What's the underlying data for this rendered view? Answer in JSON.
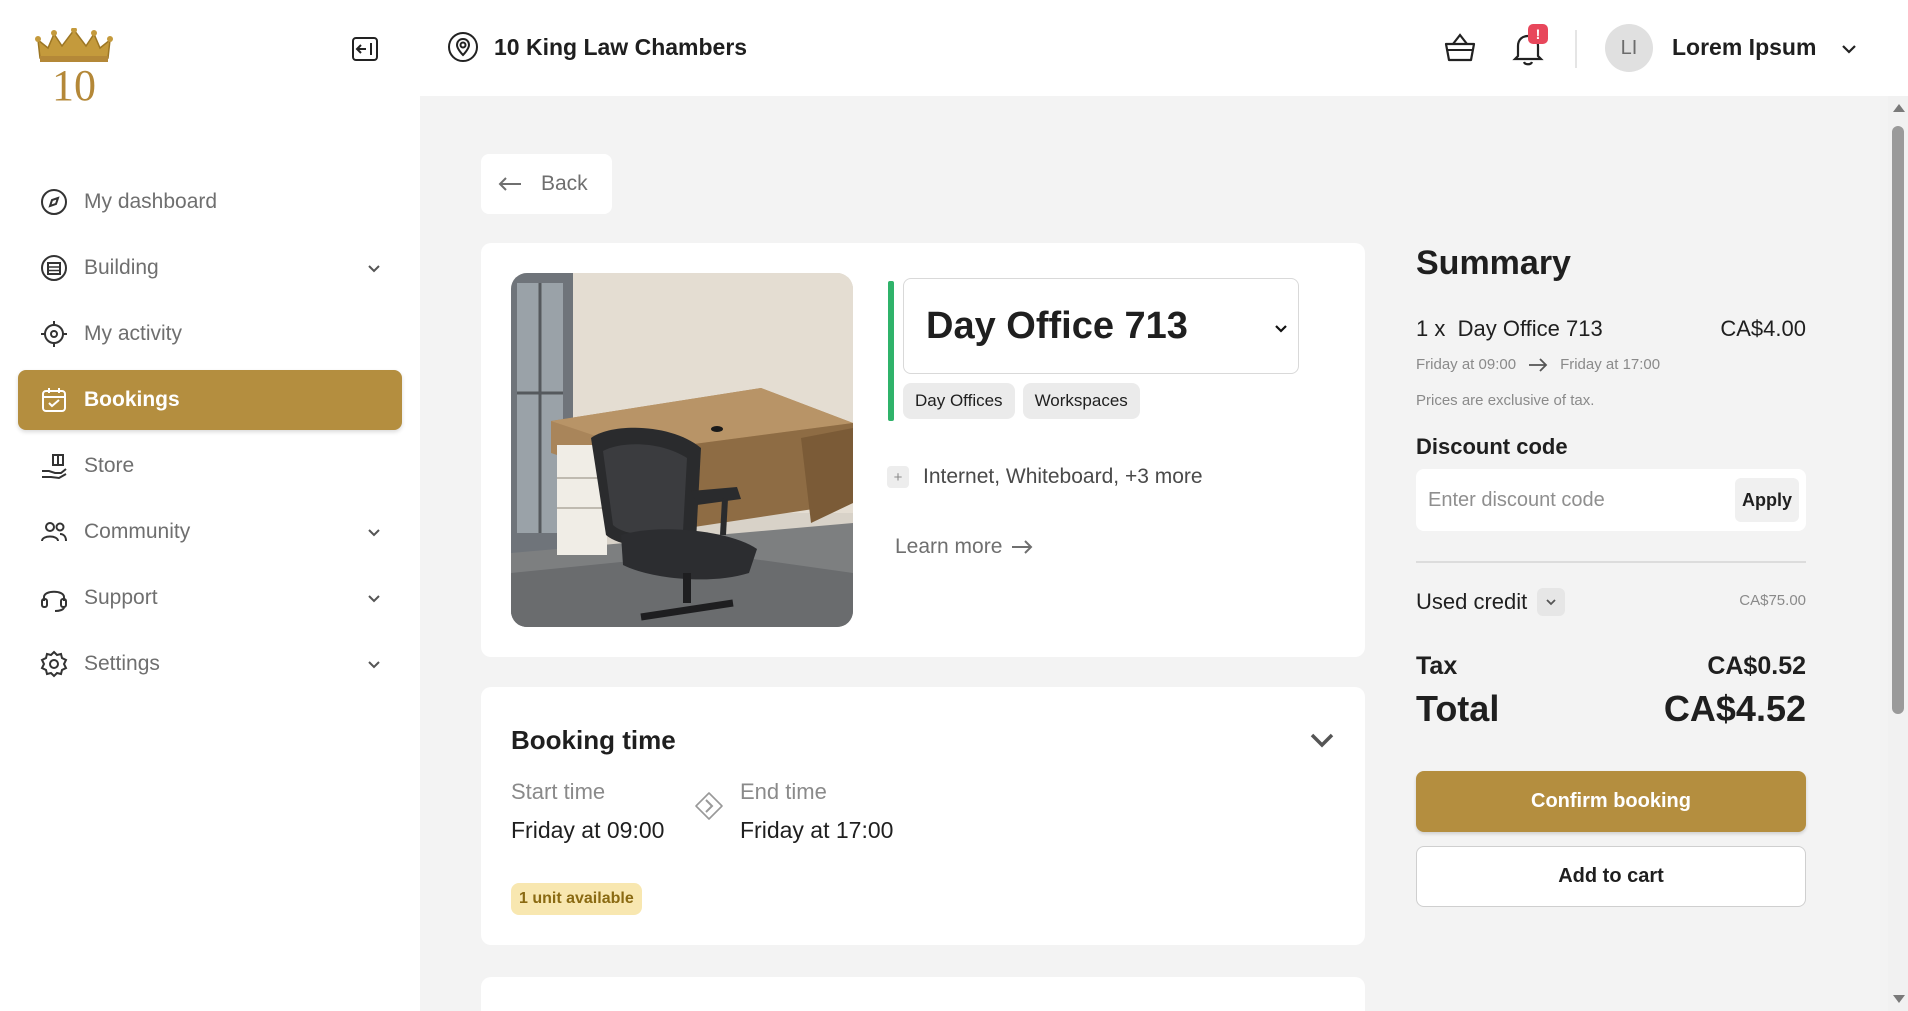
{
  "sidebar": {
    "logo_text": "10",
    "items": [
      {
        "label": "My dashboard",
        "icon": "compass-icon",
        "has_chevron": false
      },
      {
        "label": "Building",
        "icon": "building-icon",
        "has_chevron": true
      },
      {
        "label": "My activity",
        "icon": "crosshair-icon",
        "has_chevron": false
      },
      {
        "label": "Bookings",
        "icon": "calendar-icon",
        "has_chevron": false,
        "active": true
      },
      {
        "label": "Store",
        "icon": "hand-gift-icon",
        "has_chevron": false
      },
      {
        "label": "Community",
        "icon": "people-icon",
        "has_chevron": true
      },
      {
        "label": "Support",
        "icon": "headset-icon",
        "has_chevron": true
      },
      {
        "label": "Settings",
        "icon": "gear-icon",
        "has_chevron": true
      }
    ]
  },
  "header": {
    "location": "10 King Law Chambers",
    "notification_badge": "!",
    "user_initials": "LI",
    "user_name": "Lorem Ipsum"
  },
  "main": {
    "back_label": "Back",
    "office": {
      "name": "Day Office 713",
      "tags": [
        "Day Offices",
        "Workspaces"
      ],
      "amenities_plus": "+",
      "amenities": "Internet, Whiteboard, +3 more",
      "learn_more": "Learn more"
    },
    "booking_time": {
      "title": "Booking time",
      "start_label": "Start time",
      "start_value": "Friday at 09:00",
      "end_label": "End time",
      "end_value": "Friday at 17:00",
      "availability": "1 unit available"
    }
  },
  "summary": {
    "title": "Summary",
    "line_qty": "1 x",
    "line_name": "Day Office 713",
    "line_price": "CA$4.00",
    "start": "Friday at 09:00",
    "end": "Friday at 17:00",
    "tax_note": "Prices are exclusive of tax.",
    "discount_label": "Discount code",
    "discount_placeholder": "Enter discount code",
    "apply_label": "Apply",
    "used_credit_label": "Used credit",
    "used_credit_amount": "CA$75.00",
    "tax_label": "Tax",
    "tax_amount": "CA$0.52",
    "total_label": "Total",
    "total_amount": "CA$4.52",
    "confirm_label": "Confirm booking",
    "cart_label": "Add to cart"
  },
  "colors": {
    "brand_gold": "#b48e3f",
    "accent_green": "#2fb36a",
    "badge_red": "#e8475b",
    "availability_bg": "#f8e7b0"
  }
}
